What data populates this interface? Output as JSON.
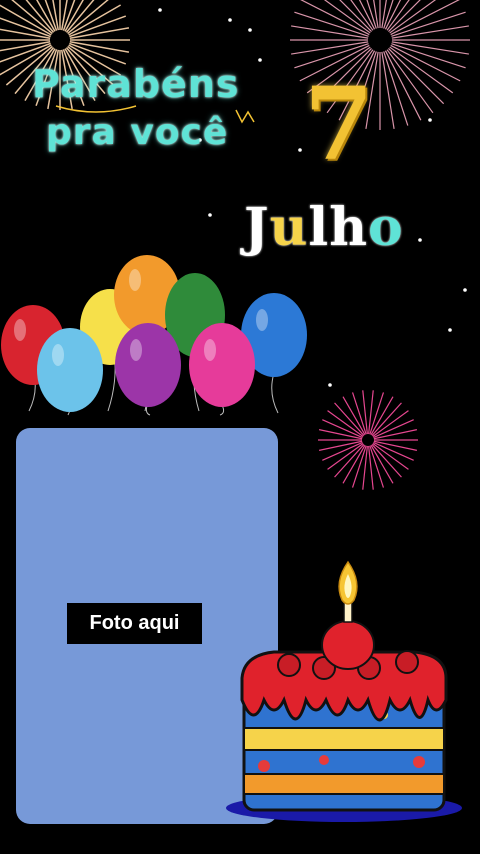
{
  "title": {
    "line1": "Parabéns",
    "line2": "pra você"
  },
  "date": {
    "day": "7",
    "month": "Julho"
  },
  "photo_placeholder": {
    "label": "Foto aqui"
  },
  "colors": {
    "background": "#000000",
    "title": "#5fe3d6",
    "day_number": "#f2c233",
    "photo_box": "#7799d8"
  },
  "decorations": {
    "balloons": [
      "red-balloon",
      "yellow-balloon",
      "orange-balloon",
      "green-balloon",
      "blue-balloon",
      "light-blue-balloon",
      "purple-balloon",
      "pink-balloon"
    ],
    "fireworks": [
      "firework-top-left",
      "firework-top-right",
      "firework-magenta"
    ],
    "cake": "birthday-cake-with-candle"
  }
}
